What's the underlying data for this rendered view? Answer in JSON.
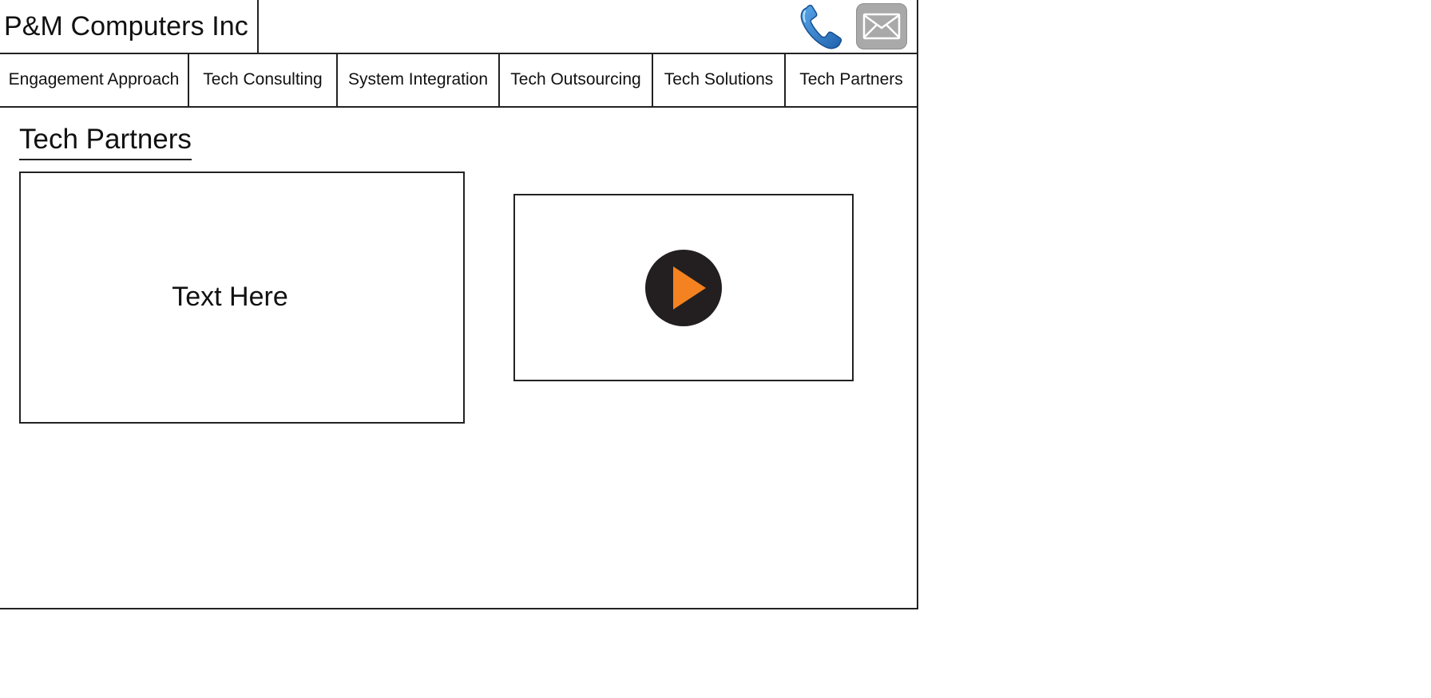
{
  "header": {
    "brand": "P&M Computers Inc",
    "contact_icons": [
      "phone-icon",
      "mail-icon"
    ]
  },
  "nav": {
    "items": [
      {
        "label": "Engagement Approach"
      },
      {
        "label": "Tech Consulting"
      },
      {
        "label": "System Integration"
      },
      {
        "label": "Tech Outsourcing"
      },
      {
        "label": "Tech Solutions"
      },
      {
        "label": "Tech Partners"
      }
    ]
  },
  "main": {
    "title": "Tech Partners",
    "text_box": "Text Here",
    "video": {
      "icon": "play-icon"
    }
  },
  "colors": {
    "phone_blue": "#2f7fcf",
    "mail_gray": "#a9a9a9",
    "play_orange": "#f58220",
    "play_bg": "#231f20",
    "border": "#222222"
  }
}
